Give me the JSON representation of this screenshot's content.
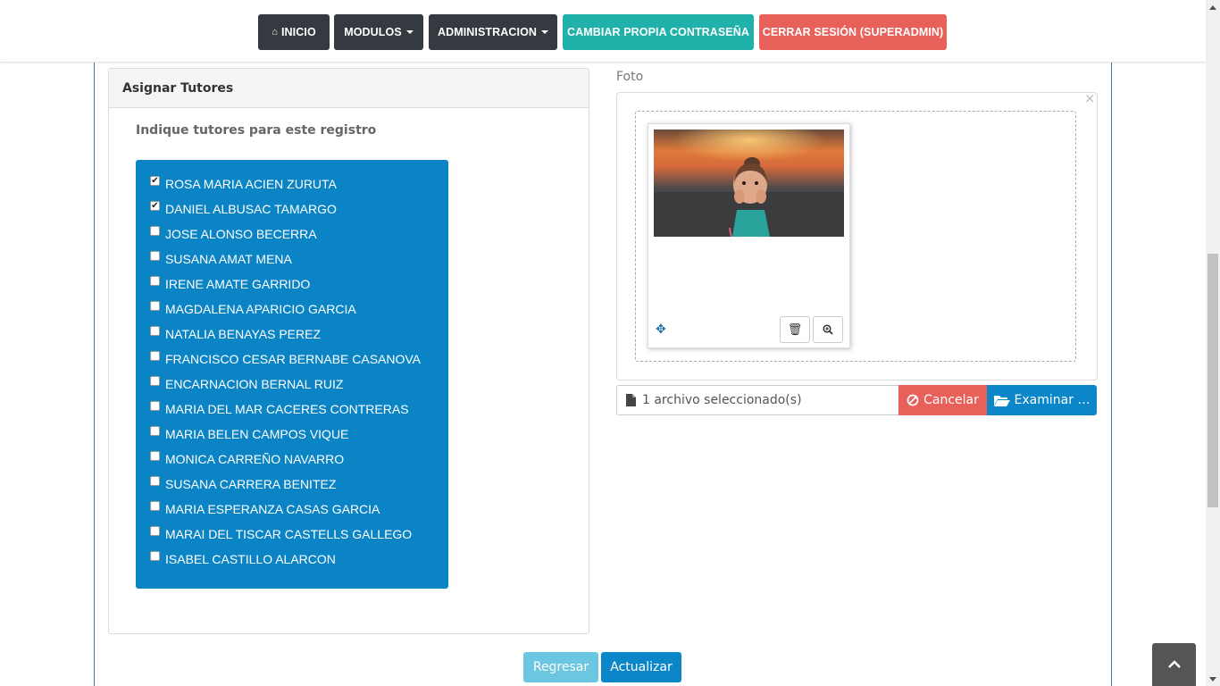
{
  "navbar": {
    "inicio": "INICIO",
    "modulos": "MODULOS",
    "administracion": "ADMINISTRACION",
    "cambiar": "CAMBIAR PROPIA CONTRASEÑA",
    "cerrar": "CERRAR SESIÓN (SUPERADMIN)"
  },
  "tutores": {
    "heading": "Asignar Tutores",
    "subtitle": "Indique tutores para este registro",
    "items": [
      {
        "label": "ROSA MARIA ACIEN ZURUTA",
        "checked": true
      },
      {
        "label": "DANIEL ALBUSAC TAMARGO",
        "checked": true
      },
      {
        "label": "JOSE ALONSO BECERRA",
        "checked": false
      },
      {
        "label": "SUSANA AMAT MENA",
        "checked": false
      },
      {
        "label": "IRENE AMATE GARRIDO",
        "checked": false
      },
      {
        "label": "MAGDALENA APARICIO GARCIA",
        "checked": false
      },
      {
        "label": "NATALIA BENAYAS PEREZ",
        "checked": false
      },
      {
        "label": "FRANCISCO CESAR BERNABE CASANOVA",
        "checked": false
      },
      {
        "label": "ENCARNACION BERNAL RUIZ",
        "checked": false
      },
      {
        "label": "MARIA DEL MAR CACERES CONTRERAS",
        "checked": false
      },
      {
        "label": "MARIA BELEN CAMPOS VIQUE",
        "checked": false
      },
      {
        "label": "MONICA CARREÑO NAVARRO",
        "checked": false
      },
      {
        "label": "SUSANA CARRERA BENITEZ",
        "checked": false
      },
      {
        "label": "MARIA ESPERANZA CASAS GARCIA",
        "checked": false
      },
      {
        "label": "MARAI DEL TISCAR CASTELLS GALLEGO",
        "checked": false
      },
      {
        "label": "ISABEL CASTILLO ALARCON",
        "checked": false
      }
    ]
  },
  "foto": {
    "label": "Foto",
    "file_status": "1 archivo seleccionado(s)",
    "cancel_label": "Cancelar",
    "browse_label": "Examinar …"
  },
  "actions": {
    "back_label": "Regresar",
    "update_label": "Actualizar"
  },
  "colors": {
    "primary": "#0b84c6",
    "danger": "#e8605a",
    "teal": "#20b2aa",
    "dark": "#343a40",
    "info": "#5bc0de"
  }
}
